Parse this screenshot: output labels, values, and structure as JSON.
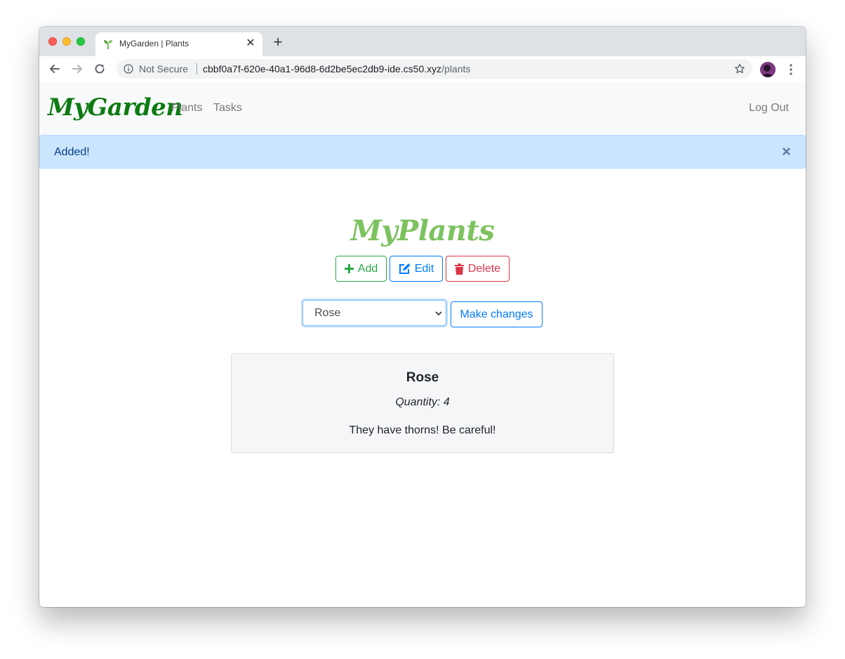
{
  "browser": {
    "tab_title": "MyGarden | Plants",
    "security_label": "Not Secure",
    "url_host": "cbbf0a7f-620e-40a1-96d8-6d2be5ec2db9-ide.cs50.xyz",
    "url_path": "/plants"
  },
  "navbar": {
    "brand": "MyGarden",
    "links": [
      "Plants",
      "Tasks"
    ],
    "logout": "Log Out"
  },
  "alert": {
    "message": "Added!",
    "close": "×"
  },
  "page": {
    "heading": "MyPlants",
    "add_label": "Add",
    "edit_label": "Edit",
    "delete_label": "Delete",
    "select_value": "Rose",
    "make_changes_label": "Make changes"
  },
  "plant_card": {
    "name": "Rose",
    "quantity": "Quantity: 4",
    "description": "They have thorns! Be careful!"
  },
  "colors": {
    "brand": "#0d7a12",
    "heading": "#7cc25f",
    "success": "#28a745",
    "primary": "#007bff",
    "danger": "#dc3545",
    "alert_bg": "#cce5ff"
  },
  "icons": {
    "favicon": "seedling-icon",
    "add": "plus-icon",
    "edit": "pencil-square-icon",
    "delete": "trash-icon"
  }
}
